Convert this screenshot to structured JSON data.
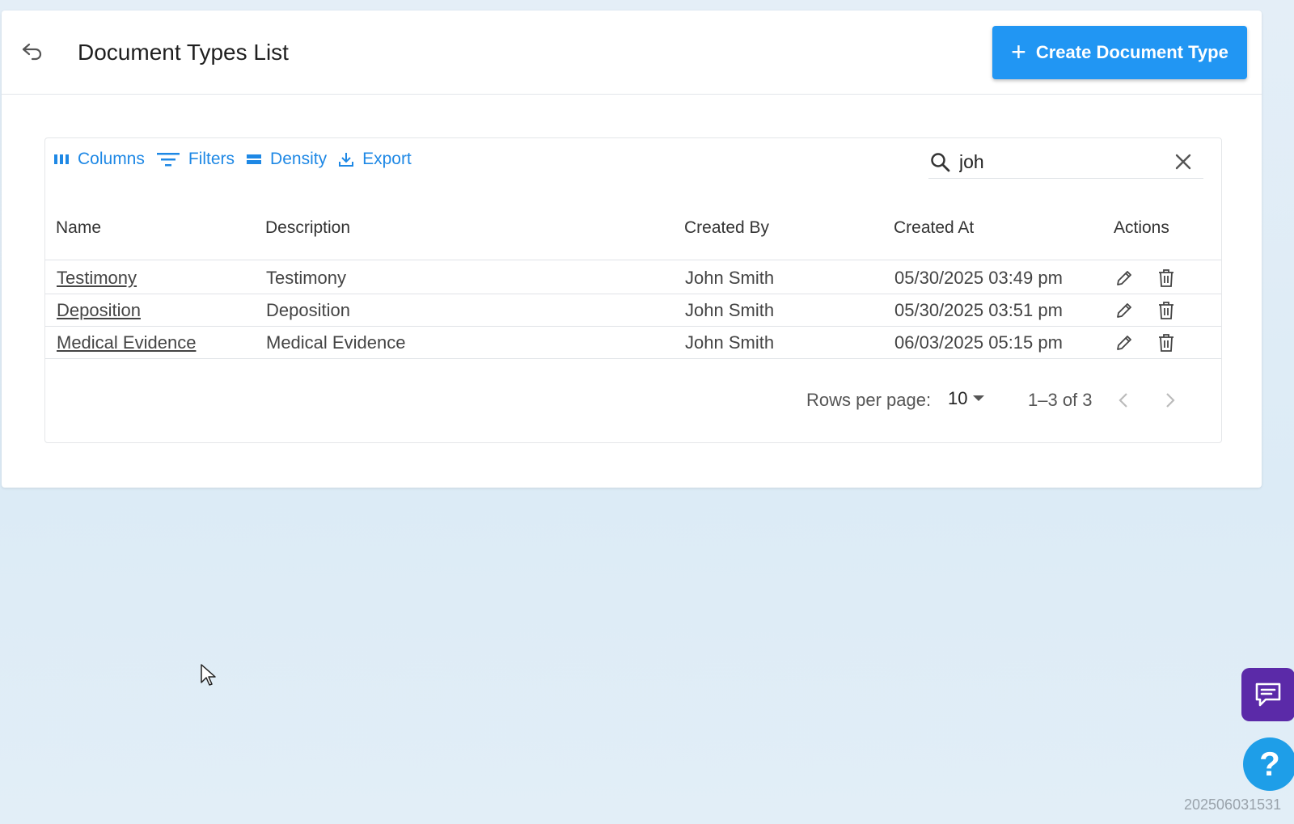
{
  "header": {
    "title": "Document Types List",
    "create_button_label": "Create Document Type"
  },
  "toolbar": {
    "columns_label": "Columns",
    "filters_label": "Filters",
    "density_label": "Density",
    "export_label": "Export"
  },
  "search": {
    "value": "joh"
  },
  "table": {
    "headers": [
      "Name",
      "Description",
      "Created By",
      "Created At",
      "Actions"
    ],
    "rows": [
      {
        "name": "Testimony",
        "description": "Testimony",
        "created_by": "John Smith",
        "created_at": "05/30/2025 03:49 pm"
      },
      {
        "name": "Deposition",
        "description": "Deposition",
        "created_by": "John Smith",
        "created_at": "05/30/2025 03:51 pm"
      },
      {
        "name": "Medical Evidence",
        "description": "Medical Evidence",
        "created_by": "John Smith",
        "created_at": "06/03/2025 05:15 pm"
      }
    ]
  },
  "pagination": {
    "rows_per_page_label": "Rows per page:",
    "rows_per_page_value": "10",
    "range_text": "1–3 of 3"
  },
  "help": {
    "symbol": "?"
  },
  "footer": {
    "build_id": "202506031531"
  },
  "colors": {
    "primary": "#2196f3",
    "chat": "#5b2aa8",
    "help": "#1e9ee8"
  }
}
